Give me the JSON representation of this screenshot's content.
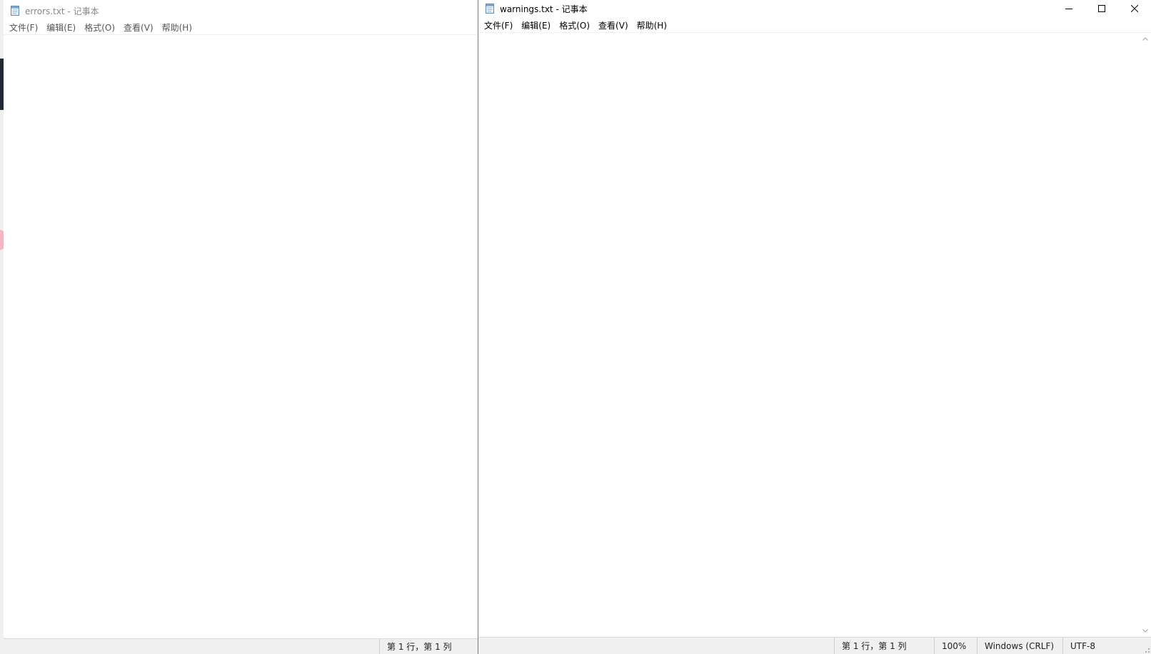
{
  "left_window": {
    "title": "errors.txt - 记事本",
    "menu": [
      "文件(F)",
      "编辑(E)",
      "格式(O)",
      "查看(V)",
      "帮助(H)"
    ],
    "content": "",
    "status": {
      "position": "第 1 行，第 1 列"
    }
  },
  "right_window": {
    "title": "warnings.txt - 记事本",
    "menu": [
      "文件(F)",
      "编辑(E)",
      "格式(O)",
      "查看(V)",
      "帮助(H)"
    ],
    "content": "",
    "status": {
      "position": "第 1 行，第 1 列",
      "zoom": "100%",
      "line_ending": "Windows (CRLF)",
      "encoding": "UTF-8"
    }
  },
  "icons": {
    "app": "notepad-icon",
    "minimize": "minimize-icon",
    "maximize": "maximize-icon",
    "close": "close-icon"
  }
}
